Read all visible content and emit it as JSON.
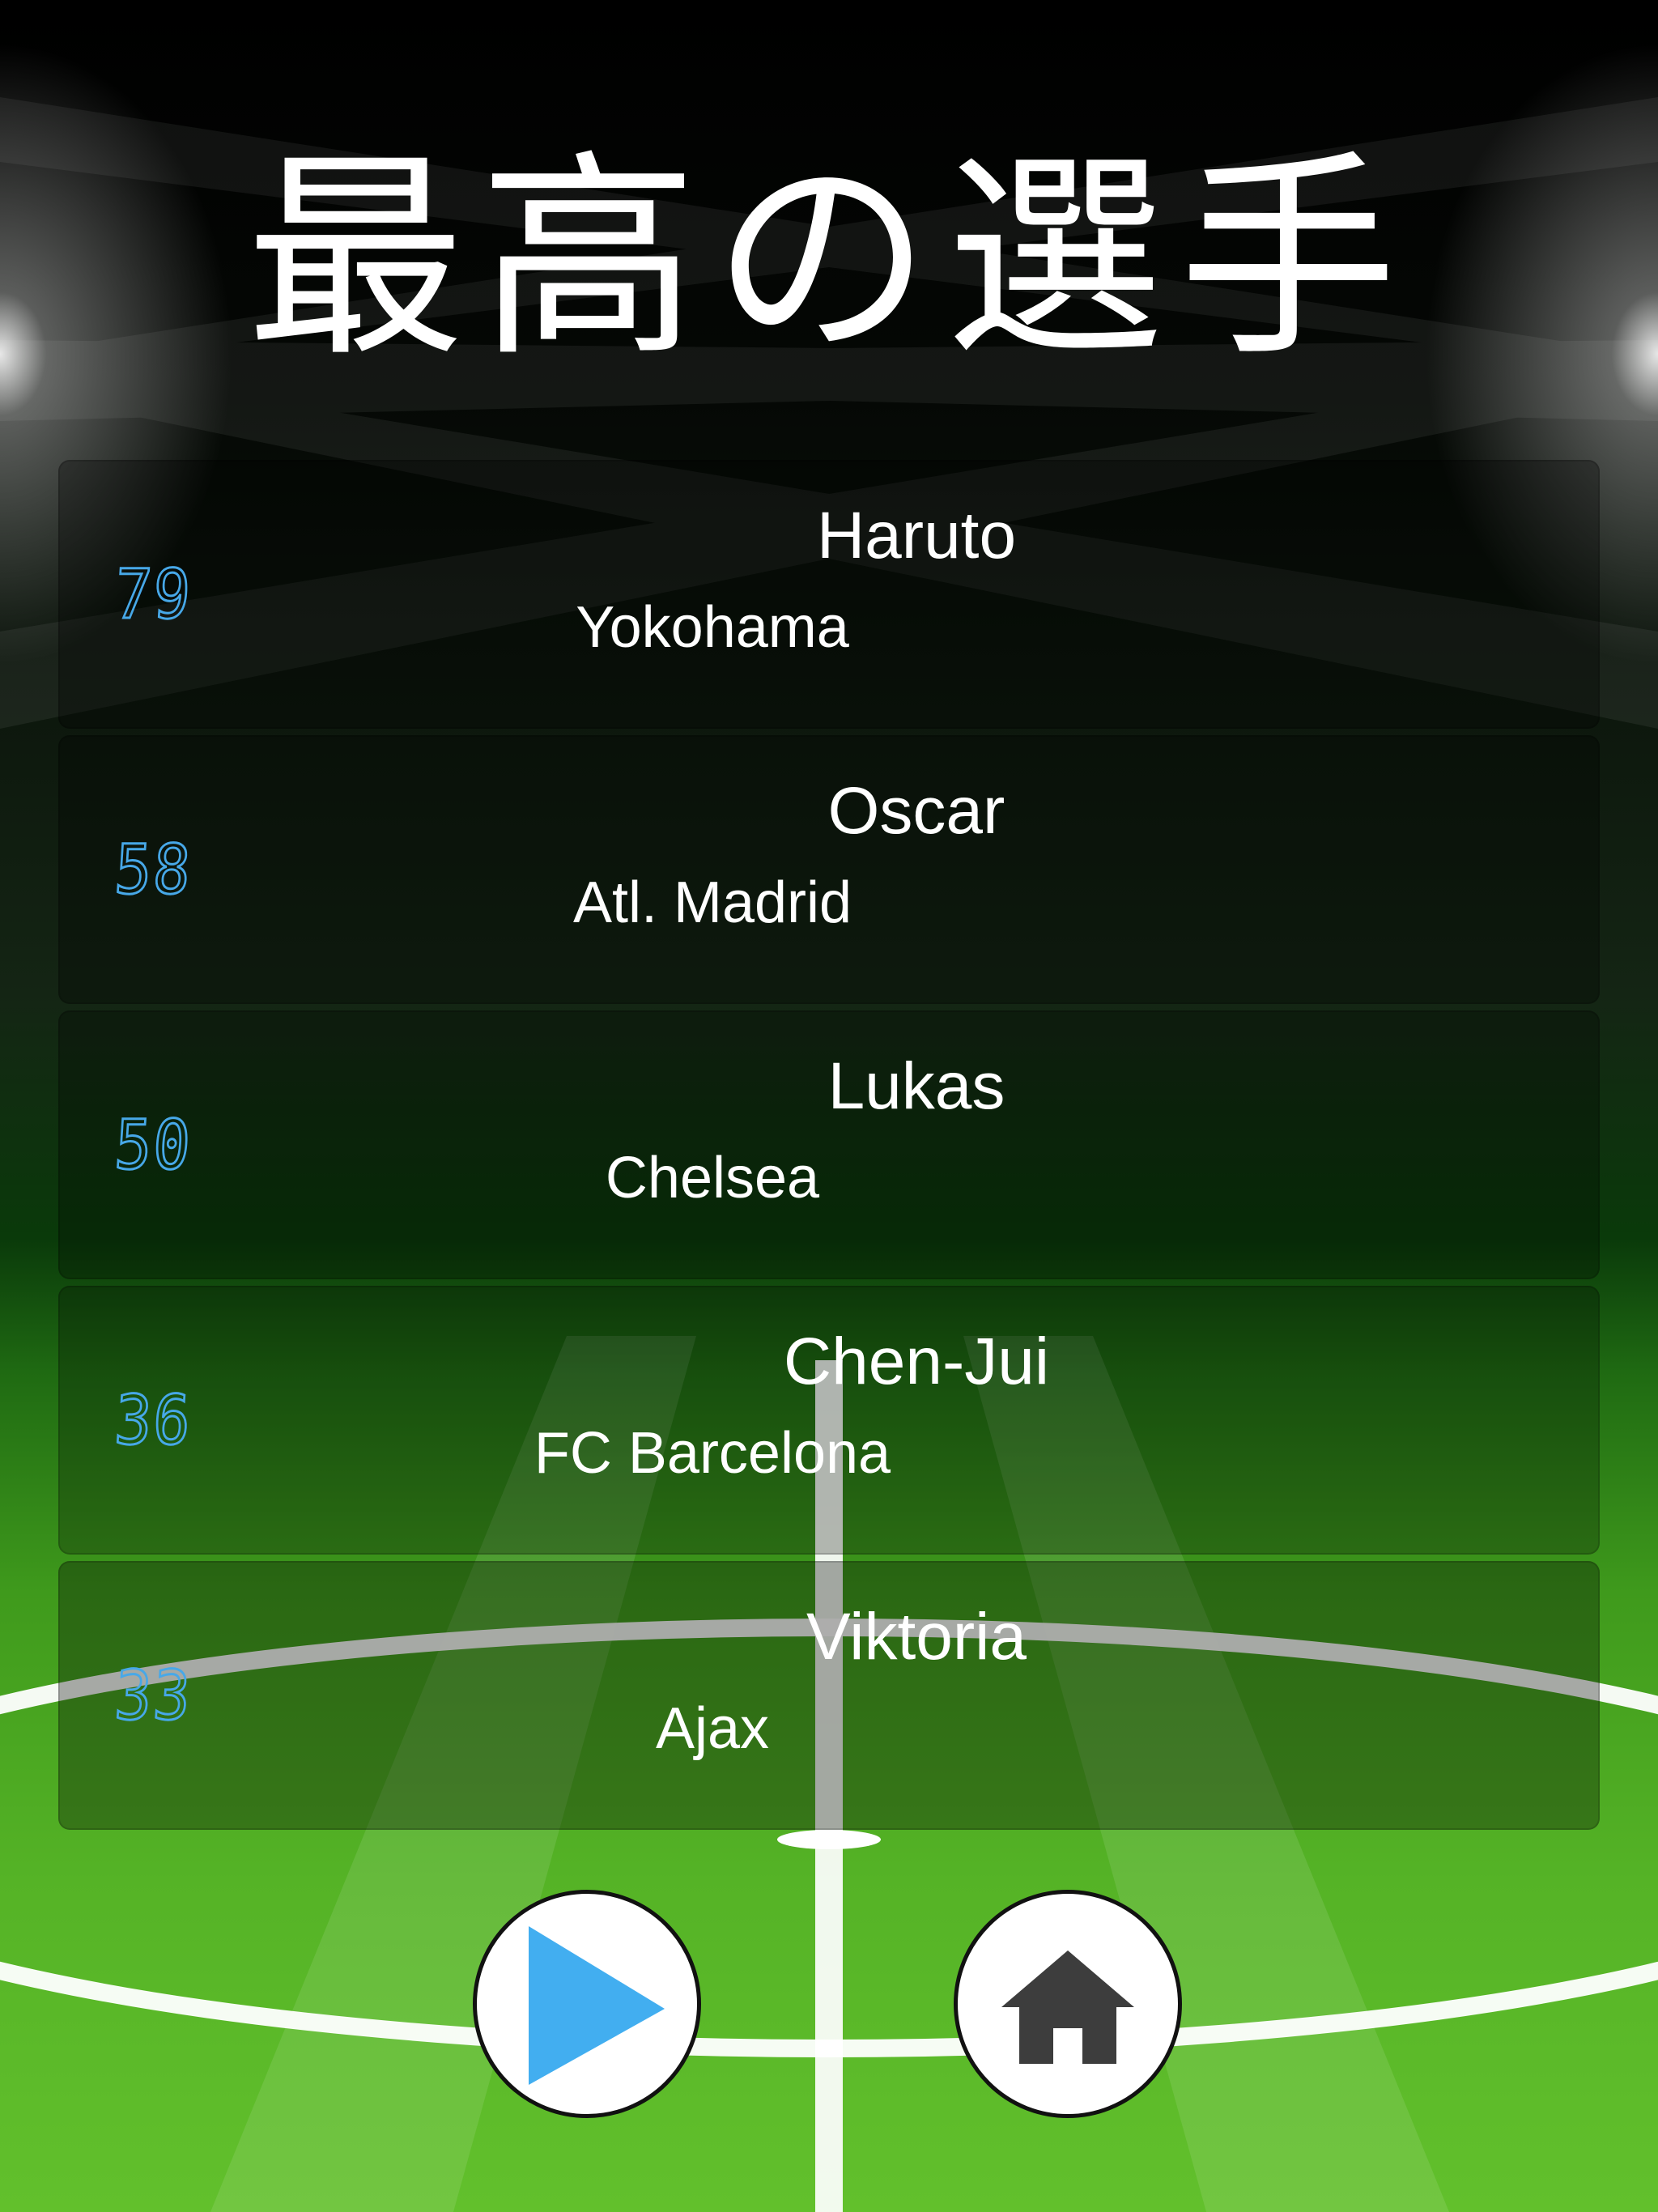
{
  "title": "最高の選手",
  "players": [
    {
      "score": "79",
      "name": "Haruto",
      "club": "Yokohama"
    },
    {
      "score": "58",
      "name": "Oscar",
      "club": "Atl. Madrid"
    },
    {
      "score": "50",
      "name": "Lukas",
      "club": "Chelsea"
    },
    {
      "score": "36",
      "name": "Chen-Jui",
      "club": "FC Barcelona"
    },
    {
      "score": "33",
      "name": "Viktoria",
      "club": "Ajax"
    }
  ],
  "buttons": {
    "play_icon": "play-icon",
    "home_icon": "home-icon"
  },
  "colors": {
    "score": "#47a8e8",
    "play_icon": "#42aef0",
    "home_icon": "#3d3d3d",
    "pitch_green": "#5cb82a",
    "line_white": "#ffffff"
  }
}
